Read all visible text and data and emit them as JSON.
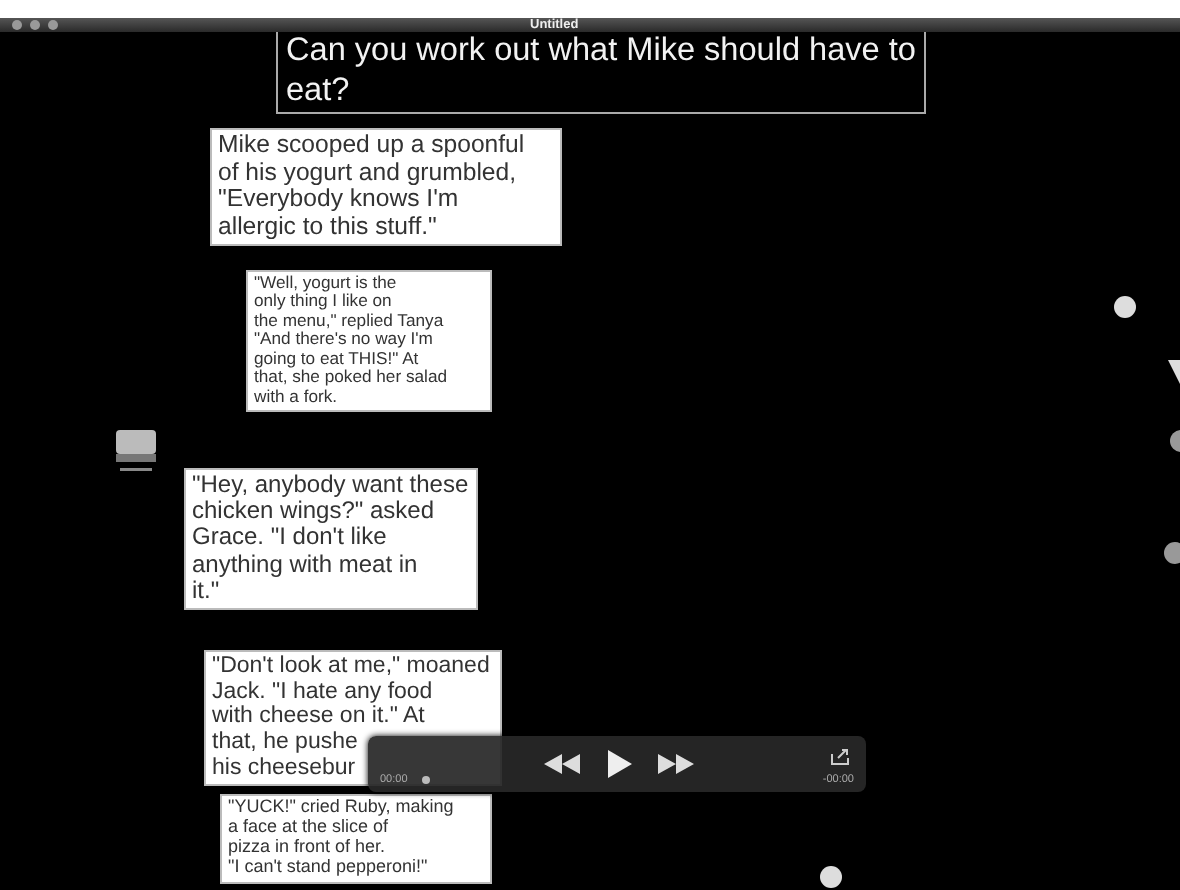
{
  "window": {
    "title": "Untitled"
  },
  "slide": {
    "question": [
      "Can you work out what Mike should have to",
      "eat?"
    ],
    "cards": [
      {
        "lines": [
          "Mike scooped up a spoonful",
          "of his yogurt and grumbled,",
          "\"Everybody knows I'm",
          "allergic to this stuff.\""
        ]
      },
      {
        "lines": [
          "\"Well, yogurt is the",
          "only thing I like on",
          "the menu,\" replied Tanya",
          "\"And there's no way I'm",
          "going to eat THIS!\" At",
          "that, she poked her salad",
          "with a fork."
        ]
      },
      {
        "lines": [
          "\"Hey, anybody want these",
          "chicken wings?\" asked",
          "Grace. \"I don't like",
          "anything with meat in",
          "it.\""
        ]
      },
      {
        "lines": [
          "\"Don't look at me,\" moaned",
          "Jack. \"I hate any food",
          "with cheese on it.\" At",
          "that, he pushe",
          "his cheesebur"
        ]
      },
      {
        "lines": [
          "\"YUCK!\" cried Ruby, making",
          "a face at the slice of",
          "pizza in front of her.",
          "\"I can't stand pepperoni!\""
        ]
      }
    ]
  },
  "player": {
    "elapsed": "00:00",
    "remaining": "-00:00"
  }
}
